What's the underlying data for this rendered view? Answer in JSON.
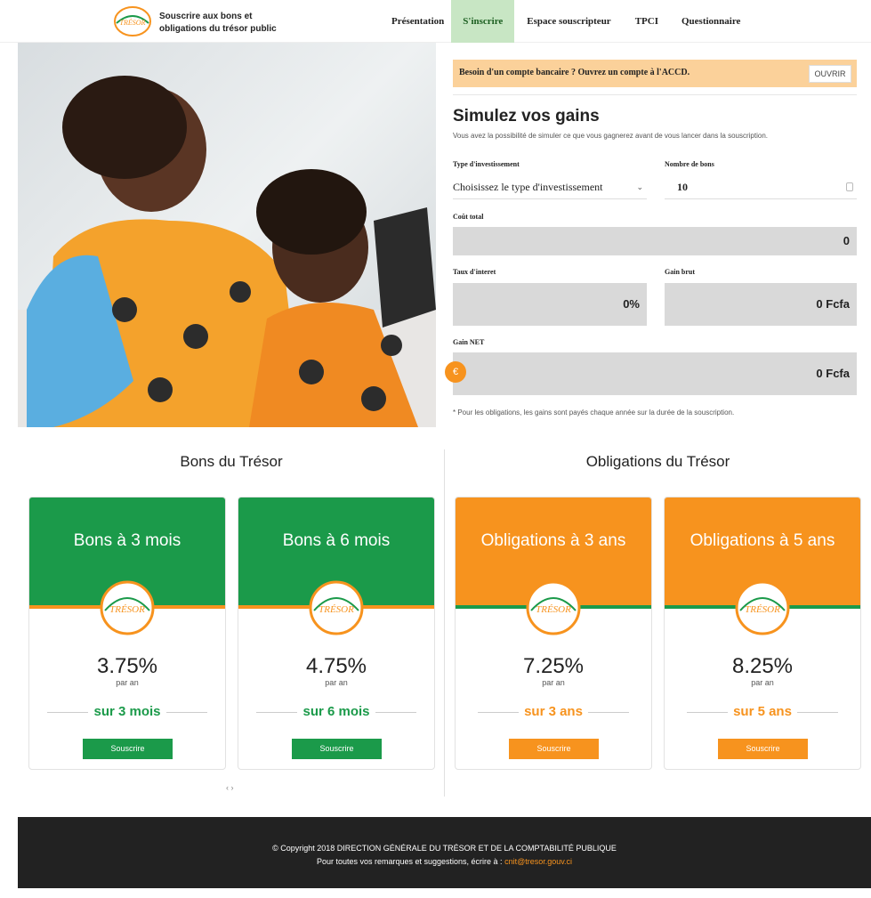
{
  "header": {
    "brand_line1": "Souscrire aux bons et",
    "brand_line2": "obligations du trésor public",
    "nav": [
      {
        "label": "Présentation",
        "active": false
      },
      {
        "label": "S'inscrire",
        "active": true
      },
      {
        "label": "Espace souscripteur",
        "active": false
      },
      {
        "label": "TPCI",
        "active": false
      },
      {
        "label": "Questionnaire",
        "active": false
      }
    ]
  },
  "simulator": {
    "banner_text": "Besoin d'un compte bancaire ? Ouvrez un compte à l'ACCD.",
    "banner_button": "OUVRIR",
    "title": "Simulez vos gains",
    "subtitle": "Vous avez la possibilité de simuler ce que vous gagnerez avant de vous lancer dans la souscription.",
    "type_label": "Type d'investissement",
    "type_value": "Choisissez le type d'investissement",
    "count_label": "Nombre de bons",
    "count_value": "10",
    "cost_label": "Coût total",
    "cost_value": "0",
    "rate_label": "Taux d'interet",
    "rate_value": "0%",
    "gross_label": "Gain brut",
    "gross_value": "0 Fcfa",
    "net_label": "Gain NET",
    "net_value": "0 Fcfa",
    "currency_icon": "€",
    "note": "* Pour les obligations, les gains sont payés chaque année sur la durée de la souscription."
  },
  "sections": {
    "bons_title": "Bons du Trésor",
    "obligations_title": "Obligations du Trésor"
  },
  "cards": [
    {
      "title": "Bons à 3 mois",
      "rate": "3.75%",
      "per": "par an",
      "duration": "sur 3 mois",
      "button": "Souscrire"
    },
    {
      "title": "Bons à 6 mois",
      "rate": "4.75%",
      "per": "par an",
      "duration": "sur 6 mois",
      "button": "Souscrire"
    },
    {
      "title": "Obligations à 3 ans",
      "rate": "7.25%",
      "per": "par an",
      "duration": "sur 3 ans",
      "button": "Souscrire"
    },
    {
      "title": "Obligations à 5 ans",
      "rate": "8.25%",
      "per": "par an",
      "duration": "sur 5 ans",
      "button": "Souscrire"
    }
  ],
  "pager": "‹ ›",
  "footer": {
    "copyright": "© Copyright 2018 DIRECTION GÉNÉRALE DU TRÉSOR ET DE LA COMPTABILITÉ PUBLIQUE",
    "contact_prefix": "Pour toutes vos remarques et suggestions, écrire à :",
    "email": "cnit@tresor.gouv.ci"
  },
  "colors": {
    "green": "#1b9a4a",
    "orange": "#f7931e",
    "banner": "#fbd19a",
    "active_nav": "#c8e6c4",
    "output_bg": "#d9d9d9",
    "footer_bg": "#222222"
  },
  "icons": {
    "logo": "tresor-seal-logo",
    "currency": "euro-icon",
    "select_chevron": "chevron-down-icon",
    "number_spinner": "spinner-icon"
  }
}
